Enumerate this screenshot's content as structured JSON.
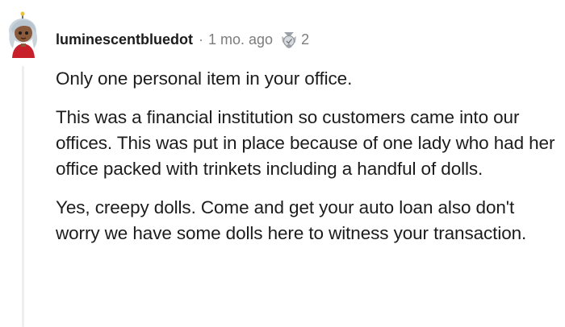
{
  "comment": {
    "author": "luminescentbluedot",
    "separator": "·",
    "timestamp": "1 mo. ago",
    "award_icon": "silver-award-icon",
    "award_count": "2",
    "paragraphs": [
      "Only one personal item in your office.",
      "This was a financial institution so customers came into our offices. This was put in place because of one lady who had her office packed with trinkets including a handful of dolls.",
      "Yes, creepy dolls. Come and get your auto loan also don't worry we have some dolls here to witness your transaction."
    ]
  },
  "colors": {
    "text": "#1c1c1c",
    "meta_text": "#7c7c7c",
    "thread_line": "#eceef0",
    "avatar_skin": "#8a5a3c",
    "avatar_hair": "#c9d4dc",
    "avatar_shirt": "#c8202a"
  }
}
